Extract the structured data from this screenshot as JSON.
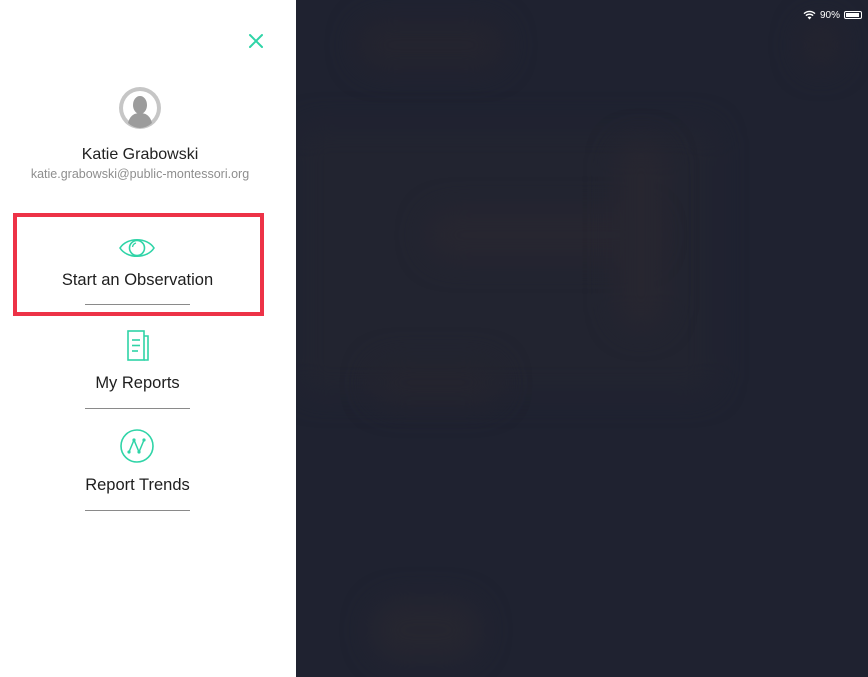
{
  "status_bar": {
    "battery_percent": "90%",
    "battery_level": 0.9,
    "wifi_icon": "wifi-icon",
    "battery_icon": "battery-icon"
  },
  "drawer": {
    "close_icon": "close-icon",
    "user": {
      "avatar_icon": "user-avatar-icon",
      "name": "Katie Grabowski",
      "email": "katie.grabowski@public-montessori.org"
    },
    "menu": [
      {
        "label": "Start an Observation",
        "icon": "eye-icon",
        "highlighted": true
      },
      {
        "label": "My Reports",
        "icon": "document-icon",
        "highlighted": false
      },
      {
        "label": "Report Trends",
        "icon": "trend-line-icon",
        "highlighted": false
      }
    ]
  },
  "colors": {
    "accent": "#2fd4a7",
    "highlight": "#ed3247",
    "app_background": "#1f2230",
    "divider": "#8a8a8a"
  }
}
